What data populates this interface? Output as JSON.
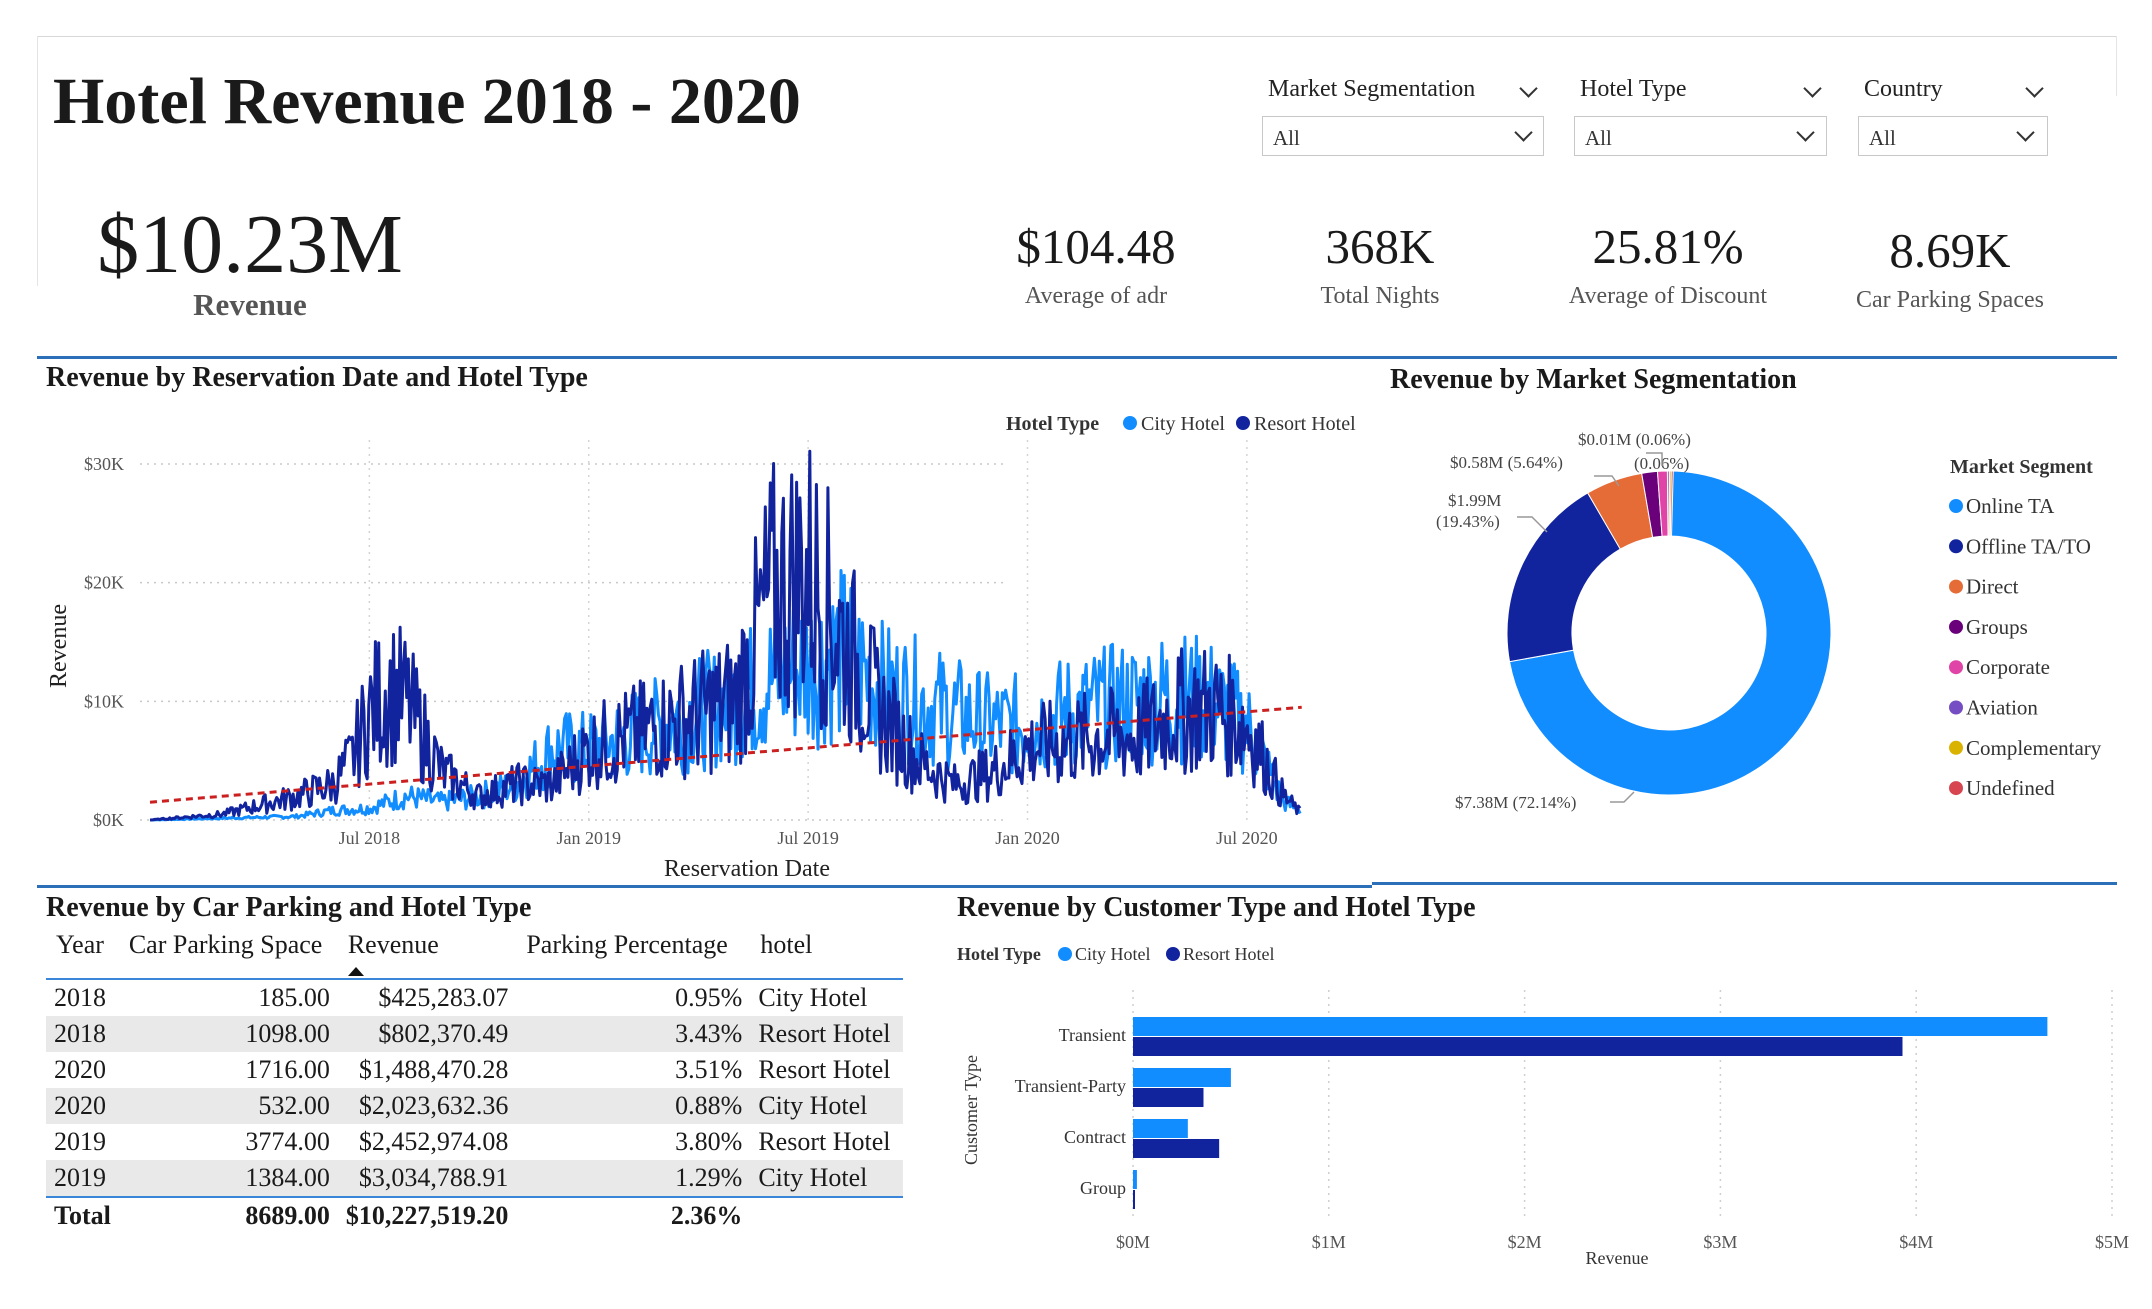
{
  "title": "Hotel Revenue 2018 - 2020",
  "slicers": [
    {
      "label": "Market Segmentation",
      "value": "All"
    },
    {
      "label": "Hotel Type",
      "value": "All"
    },
    {
      "label": "Country",
      "value": "All"
    }
  ],
  "revenue_card": {
    "value": "$10.23M",
    "label": "Revenue"
  },
  "kpis": [
    {
      "value": "$104.48",
      "label": "Average of adr"
    },
    {
      "value": "368K",
      "label": "Total Nights"
    },
    {
      "value": "25.81%",
      "label": "Average of Discount"
    },
    {
      "value": "8.69K",
      "label": "Car Parking Spaces"
    }
  ],
  "colors": {
    "city": "#118dff",
    "resort": "#12239e",
    "trend": "#cc1f1f",
    "separator": "#2a6fb8"
  },
  "line_chart_data": {
    "type": "line",
    "title": "Revenue by Reservation Date and Hotel Type",
    "legend_title": "Hotel Type",
    "series_names": [
      "City Hotel",
      "Resort Hotel"
    ],
    "xlabel": "Reservation Date",
    "ylabel": "Revenue",
    "y_ticks": [
      "$0K",
      "$10K",
      "$20K",
      "$30K"
    ],
    "x_ticks": [
      "Jul 2018",
      "Jan 2019",
      "Jul 2019",
      "Jan 2020",
      "Jul 2020"
    ],
    "ylim": [
      0,
      30000
    ],
    "x_range": [
      "2018-01-01",
      "2020-08-31"
    ],
    "trend_line": {
      "start": 1500,
      "end": 9500
    },
    "approx_profile": {
      "resort": [
        [
          0,
          0
        ],
        [
          2,
          500
        ],
        [
          4,
          2000
        ],
        [
          5,
          3000
        ],
        [
          5.5,
          5000
        ],
        [
          6,
          9000
        ],
        [
          6.5,
          11000
        ],
        [
          7,
          10000
        ],
        [
          8,
          4000
        ],
        [
          9,
          2000
        ],
        [
          10,
          3000
        ],
        [
          11,
          3000
        ],
        [
          12,
          6000
        ],
        [
          13,
          7000
        ],
        [
          14,
          8000
        ],
        [
          15,
          9000
        ],
        [
          16,
          10000
        ],
        [
          17,
          19000
        ],
        [
          18,
          21000
        ],
        [
          19,
          15000
        ],
        [
          20,
          9000
        ],
        [
          21,
          5000
        ],
        [
          22,
          3000
        ],
        [
          23,
          4000
        ],
        [
          24,
          6000
        ],
        [
          26,
          7000
        ],
        [
          27,
          7000
        ],
        [
          28,
          9000
        ],
        [
          29,
          9500
        ],
        [
          30,
          8000
        ],
        [
          31,
          2000
        ],
        [
          31.5,
          500
        ]
      ],
      "city": [
        [
          0,
          0
        ],
        [
          4,
          300
        ],
        [
          5,
          800
        ],
        [
          6,
          1000
        ],
        [
          7,
          2000
        ],
        [
          8,
          1500
        ],
        [
          9,
          2000
        ],
        [
          10,
          3000
        ],
        [
          11,
          6000
        ],
        [
          12,
          6000
        ],
        [
          13,
          7000
        ],
        [
          14,
          8000
        ],
        [
          15,
          9000
        ],
        [
          16,
          10000
        ],
        [
          17,
          12000
        ],
        [
          18,
          13000
        ],
        [
          19,
          14000
        ],
        [
          20,
          11000
        ],
        [
          21,
          10000
        ],
        [
          22,
          9000
        ],
        [
          23,
          8000
        ],
        [
          24,
          8000
        ],
        [
          25,
          9000
        ],
        [
          26,
          9500
        ],
        [
          27,
          10000
        ],
        [
          28,
          10500
        ],
        [
          29,
          10000
        ],
        [
          30,
          8000
        ],
        [
          31,
          1500
        ],
        [
          31.5,
          800
        ]
      ]
    }
  },
  "donut_chart_data": {
    "type": "pie",
    "title": "Revenue by Market Segmentation",
    "legend_title": "Market Segment",
    "slices": [
      {
        "name": "Online TA",
        "value": 7.38,
        "label": "$7.38M (72.14%)",
        "color": "#118dff"
      },
      {
        "name": "Offline TA/TO",
        "value": 1.99,
        "label": "$1.99M (19.43%)",
        "color": "#12239e"
      },
      {
        "name": "Direct",
        "value": 0.58,
        "label": "$0.58M (5.64%)",
        "color": "#e66c37"
      },
      {
        "name": "Groups",
        "value": 0.16,
        "label": "",
        "color": "#6b007b"
      },
      {
        "name": "Corporate",
        "value": 0.1,
        "label": "",
        "color": "#e044a7"
      },
      {
        "name": "Aviation",
        "value": 0.01,
        "label": "$0.01M (0.06%)",
        "color": "#744ec2"
      },
      {
        "name": "Complementary",
        "value": 0.005,
        "label": "",
        "color": "#d9b300"
      },
      {
        "name": "Undefined",
        "value": 0.001,
        "label": "",
        "color": "#d64550"
      }
    ],
    "overlap_label": "(0.06%)",
    "label_lines": [
      {
        "top": "$1.99M",
        "bottom": "(19.43%)"
      }
    ]
  },
  "table": {
    "title": "Revenue by Car Parking and Hotel Type",
    "columns": [
      "Year",
      "Car Parking Space",
      "Revenue",
      "Parking Percentage",
      "hotel"
    ],
    "rows": [
      [
        "2018",
        "185.00",
        "$425,283.07",
        "0.95%",
        "City Hotel"
      ],
      [
        "2018",
        "1098.00",
        "$802,370.49",
        "3.43%",
        "Resort Hotel"
      ],
      [
        "2020",
        "1716.00",
        "$1,488,470.28",
        "3.51%",
        "Resort Hotel"
      ],
      [
        "2020",
        "532.00",
        "$2,023,632.36",
        "0.88%",
        "City Hotel"
      ],
      [
        "2019",
        "3774.00",
        "$2,452,974.08",
        "3.80%",
        "Resort Hotel"
      ],
      [
        "2019",
        "1384.00",
        "$3,034,788.91",
        "1.29%",
        "City Hotel"
      ]
    ],
    "total": [
      "Total",
      "8689.00",
      "$10,227,519.20",
      "2.36%",
      ""
    ]
  },
  "chart_data": {
    "type": "bar",
    "title": "Revenue by Customer Type and Hotel Type",
    "legend_title": "Hotel Type",
    "categories": [
      "Transient",
      "Transient-Party",
      "Contract",
      "Group"
    ],
    "series": [
      {
        "name": "City Hotel",
        "values": [
          4.67,
          0.5,
          0.28,
          0.02
        ]
      },
      {
        "name": "Resort Hotel",
        "values": [
          3.93,
          0.36,
          0.44,
          0.01
        ]
      }
    ],
    "x_ticks": [
      "$0M",
      "$1M",
      "$2M",
      "$3M",
      "$4M",
      "$5M"
    ],
    "xlim": [
      0,
      5
    ],
    "xlabel": "Revenue",
    "ylabel": "Customer Type"
  }
}
